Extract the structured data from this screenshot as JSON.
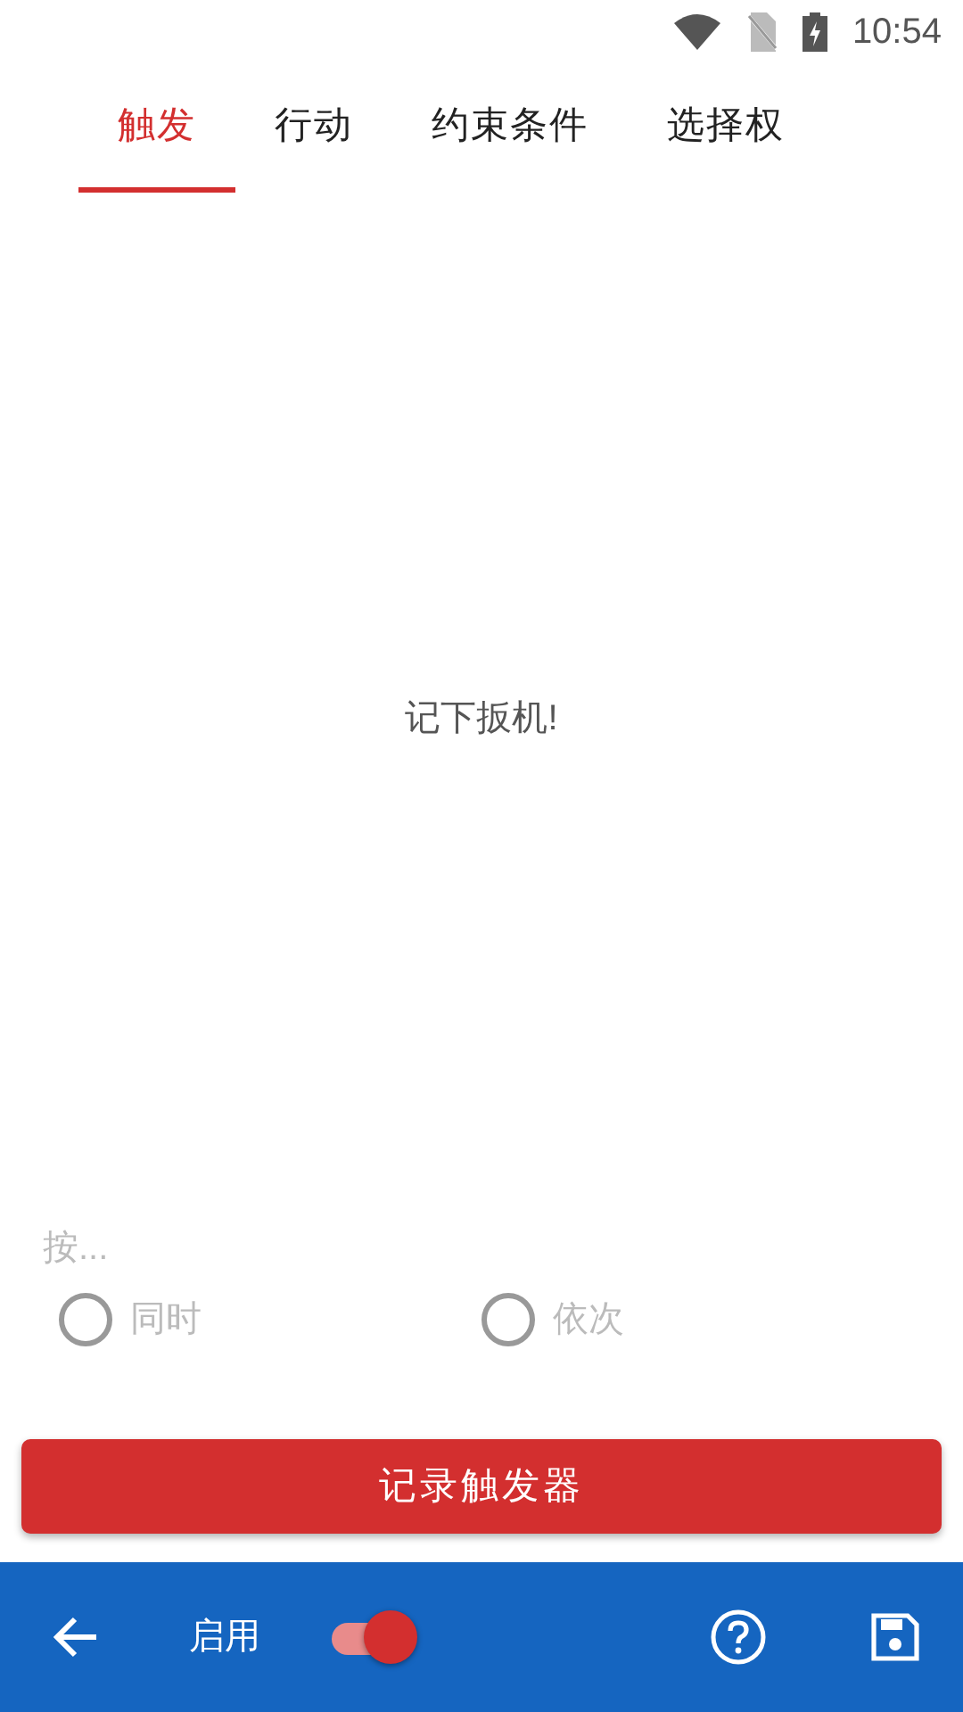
{
  "status_bar": {
    "time": "10:54"
  },
  "tabs": [
    {
      "label": "触发",
      "selected": true
    },
    {
      "label": "行动",
      "selected": false
    },
    {
      "label": "约束条件",
      "selected": false
    },
    {
      "label": "选择权",
      "selected": false
    }
  ],
  "message": "记下扳机!",
  "press_label": "按...",
  "modes": [
    {
      "label": "同时",
      "selected": false,
      "disabled": true
    },
    {
      "label": "依次",
      "selected": false,
      "disabled": true
    }
  ],
  "record_button": "记录触发器",
  "bottom_bar": {
    "enable_label": "启用",
    "enabled": true
  }
}
